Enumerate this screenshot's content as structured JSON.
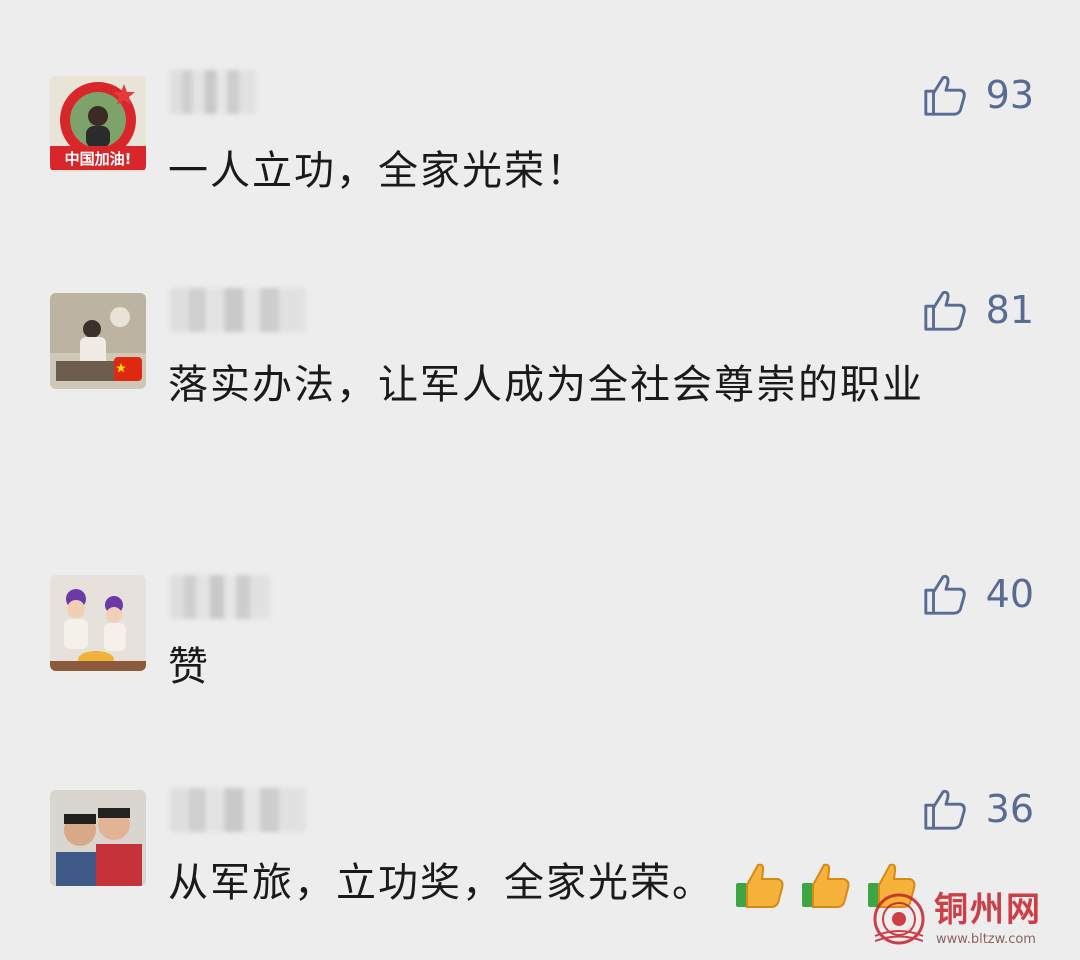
{
  "comments": [
    {
      "name": "",
      "text": "一人立功，全家光荣！",
      "likes": "93"
    },
    {
      "name": "",
      "text": "落实办法，让军人成为全社会尊崇的职业",
      "likes": "81"
    },
    {
      "name": "",
      "text": "赞",
      "likes": "40"
    },
    {
      "name": "",
      "text": "从军旅，立功奖，全家光荣。",
      "likes": "36",
      "emojis": [
        "thumbs-up-emoji",
        "thumbs-up-emoji",
        "thumbs-up-emoji"
      ]
    }
  ],
  "avatars": {
    "first_badge_text": "中国加油!"
  },
  "watermark": {
    "title": "铜州网",
    "url": "www.bltzw.com"
  },
  "colors": {
    "background": "#ededed",
    "like_blue": "#576b95",
    "text": "#1a1a1a",
    "watermark_red": "#c8202a"
  },
  "icons": {
    "like": "thumbs-up-outline-icon"
  }
}
